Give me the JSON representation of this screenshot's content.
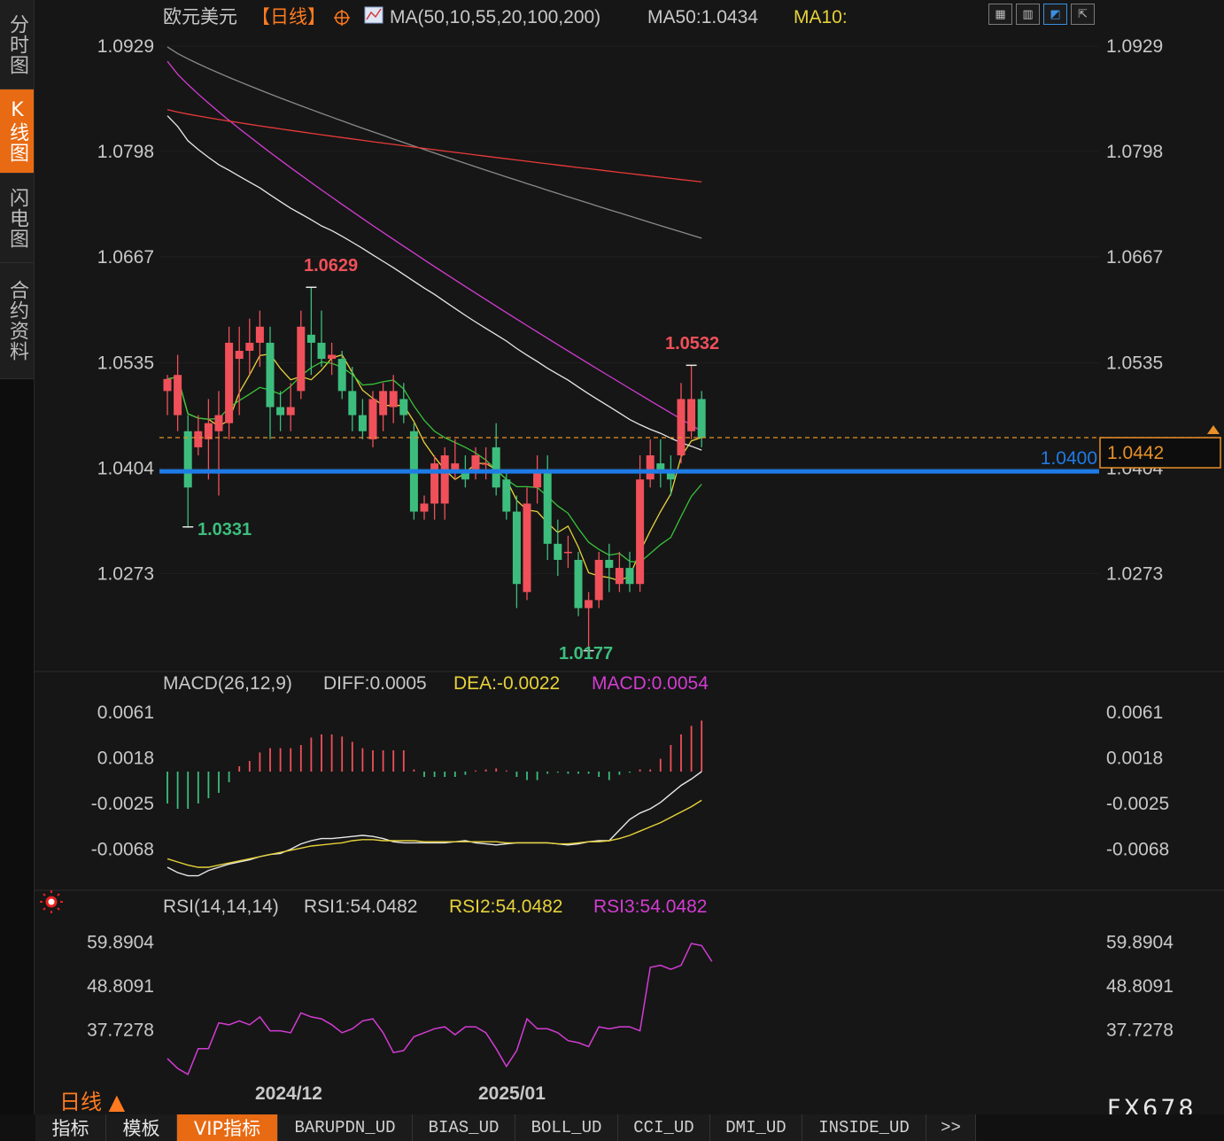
{
  "sidebar": {
    "tabs": [
      {
        "label": "分时图",
        "active": false
      },
      {
        "label": "K线图",
        "active": true
      },
      {
        "label": "闪电图",
        "active": false
      },
      {
        "label": "合约资料",
        "active": false
      }
    ]
  },
  "header": {
    "symbol": "欧元美元",
    "period": "【日线】",
    "indicator": "MA(50,10,55,20,100,200)",
    "ma50": "MA50:1.0434",
    "ma10": "MA10:"
  },
  "price_axis": {
    "ticks": [
      "1.0929",
      "1.0798",
      "1.0667",
      "1.0535",
      "1.0404",
      "1.0273"
    ],
    "current_price": "1.0442",
    "support_line": "1.0400",
    "high_label": "1.0629",
    "low_label": "1.0331",
    "recent_high_label": "1.0532",
    "recent_low_label": "1.0177"
  },
  "macd": {
    "title": "MACD(26,12,9)",
    "diff": "DIFF:0.0005",
    "dea": "DEA:-0.0022",
    "macd": "MACD:0.0054",
    "ticks": [
      "0.0061",
      "0.0018",
      "-0.0025",
      "-0.0068"
    ]
  },
  "rsi": {
    "title": "RSI(14,14,14)",
    "rsi1": "RSI1:54.0482",
    "rsi2": "RSI2:54.0482",
    "rsi3": "RSI3:54.0482",
    "ticks": [
      "59.8904",
      "48.8091",
      "37.7278"
    ]
  },
  "time_axis": [
    "2024/12",
    "2025/01"
  ],
  "period_switch": "日线 ▲",
  "bottom_tabs": [
    "指标",
    "模板",
    "VIP指标",
    "BARUPDN_UD",
    "BIAS_UD",
    "BOLL_UD",
    "CCI_UD",
    "DMI_UD",
    "INSIDE_UD",
    ">>"
  ],
  "brand": "FX678",
  "colors": {
    "up": "#f0505a",
    "down": "#3dbd7d",
    "ma_white": "#e8e8e8",
    "ma_yellow": "#e6d23a",
    "ma_green": "#39c43a",
    "ma_magenta": "#d23cd2",
    "ma_gray": "#8a8a8a",
    "ma_red": "#e83a3a",
    "support": "#1e7be6",
    "accent": "#e86a12"
  },
  "chart_data": {
    "type": "candlestick",
    "title": "欧元美元【日线】",
    "dates": [
      "2024/12",
      "2025/01"
    ],
    "ohlc": [
      [
        1.05,
        1.052,
        1.047,
        1.0515
      ],
      [
        1.047,
        1.0545,
        1.045,
        1.052
      ],
      [
        1.045,
        1.047,
        1.033,
        1.038
      ],
      [
        1.043,
        1.047,
        1.042,
        1.045
      ],
      [
        1.044,
        1.049,
        1.039,
        1.046
      ],
      [
        1.045,
        1.05,
        1.037,
        1.047
      ],
      [
        1.046,
        1.058,
        1.044,
        1.056
      ],
      [
        1.054,
        1.058,
        1.047,
        1.055
      ],
      [
        1.055,
        1.059,
        1.052,
        1.056
      ],
      [
        1.056,
        1.06,
        1.053,
        1.058
      ],
      [
        1.056,
        1.058,
        1.044,
        1.048
      ],
      [
        1.048,
        1.05,
        1.045,
        1.047
      ],
      [
        1.047,
        1.051,
        1.045,
        1.048
      ],
      [
        1.05,
        1.06,
        1.049,
        1.058
      ],
      [
        1.057,
        1.0629,
        1.052,
        1.056
      ],
      [
        1.056,
        1.06,
        1.053,
        1.054
      ],
      [
        1.054,
        1.056,
        1.052,
        1.0545
      ],
      [
        1.054,
        1.055,
        1.049,
        1.05
      ],
      [
        1.05,
        1.053,
        1.045,
        1.047
      ],
      [
        1.047,
        1.049,
        1.044,
        1.045
      ],
      [
        1.044,
        1.05,
        1.043,
        1.049
      ],
      [
        1.047,
        1.051,
        1.045,
        1.05
      ],
      [
        1.048,
        1.052,
        1.046,
        1.05
      ],
      [
        1.049,
        1.051,
        1.046,
        1.047
      ],
      [
        1.045,
        1.046,
        1.034,
        1.035
      ],
      [
        1.035,
        1.037,
        1.034,
        1.036
      ],
      [
        1.036,
        1.042,
        1.034,
        1.041
      ],
      [
        1.036,
        1.043,
        1.034,
        1.042
      ],
      [
        1.04,
        1.044,
        1.039,
        1.041
      ],
      [
        1.04,
        1.042,
        1.038,
        1.039
      ],
      [
        1.04,
        1.043,
        1.039,
        1.042
      ],
      [
        1.041,
        1.043,
        1.039,
        1.041
      ],
      [
        1.043,
        1.046,
        1.037,
        1.038
      ],
      [
        1.039,
        1.04,
        1.034,
        1.035
      ],
      [
        1.035,
        1.037,
        1.023,
        1.026
      ],
      [
        1.025,
        1.038,
        1.024,
        1.036
      ],
      [
        1.038,
        1.042,
        1.036,
        1.04
      ],
      [
        1.04,
        1.042,
        1.029,
        1.031
      ],
      [
        1.031,
        1.034,
        1.027,
        1.029
      ],
      [
        1.03,
        1.032,
        1.028,
        1.03
      ],
      [
        1.029,
        1.03,
        1.022,
        1.023
      ],
      [
        1.023,
        1.025,
        1.0177,
        1.024
      ],
      [
        1.024,
        1.03,
        1.023,
        1.029
      ],
      [
        1.029,
        1.031,
        1.025,
        1.028
      ],
      [
        1.026,
        1.03,
        1.025,
        1.028
      ],
      [
        1.028,
        1.03,
        1.025,
        1.026
      ],
      [
        1.026,
        1.042,
        1.025,
        1.039
      ],
      [
        1.039,
        1.044,
        1.038,
        1.042
      ],
      [
        1.041,
        1.044,
        1.038,
        1.04
      ],
      [
        1.04,
        1.042,
        1.037,
        1.039
      ],
      [
        1.042,
        1.051,
        1.041,
        1.049
      ],
      [
        1.045,
        1.0532,
        1.044,
        1.049
      ],
      [
        1.049,
        1.05,
        1.043,
        1.0442
      ]
    ],
    "ylim": [
      1.016,
      1.094
    ],
    "highlights": {
      "high": 1.0629,
      "low": 1.0331,
      "recent_high": 1.0532,
      "recent_low": 1.0177,
      "support": 1.04,
      "last": 1.0442
    },
    "macd": {
      "ylim": [
        -0.01,
        0.007
      ],
      "histogram": [
        -0.003,
        -0.0035,
        -0.0035,
        -0.003,
        -0.0025,
        -0.002,
        -0.001,
        0.0005,
        0.001,
        0.0018,
        0.0022,
        0.0022,
        0.0022,
        0.0025,
        0.0032,
        0.0035,
        0.0035,
        0.0033,
        0.0028,
        0.0022,
        0.002,
        0.002,
        0.002,
        0.002,
        0.0002,
        -0.0005,
        -0.0005,
        -0.0005,
        -0.0005,
        -0.0003,
        0.0001,
        0.0002,
        0.0003,
        0.0001,
        -0.0005,
        -0.0008,
        -0.0008,
        -0.0002,
        -0.0001,
        -0.0002,
        -0.0002,
        -0.0002,
        -0.0005,
        -0.0008,
        -0.0003,
        -0.0001,
        0.0002,
        0.0002,
        0.0012,
        0.0025,
        0.0035,
        0.0043,
        0.0048,
        0.0053,
        0.0058,
        0.0058,
        0.0054
      ],
      "diff": [
        -0.0085,
        -0.009,
        -0.0093,
        -0.0093,
        -0.0088,
        -0.0085,
        -0.0082,
        -0.008,
        -0.0078,
        -0.0075,
        -0.0073,
        -0.0072,
        -0.0068,
        -0.0063,
        -0.006,
        -0.0058,
        -0.0058,
        -0.0057,
        -0.0056,
        -0.0055,
        -0.0056,
        -0.0058,
        -0.0061,
        -0.0062,
        -0.0062,
        -0.0062,
        -0.0062,
        -0.0062,
        -0.0061,
        -0.006,
        -0.0062,
        -0.0063,
        -0.0064,
        -0.0063,
        -0.0062,
        -0.0062,
        -0.0062,
        -0.0062,
        -0.0063,
        -0.0064,
        -0.0063,
        -0.0061,
        -0.006,
        -0.006,
        -0.005,
        -0.004,
        -0.0034,
        -0.003,
        -0.0024,
        -0.0016,
        -0.0008,
        -0.0002,
        0.0005
      ],
      "dea": [
        -0.0077,
        -0.008,
        -0.0083,
        -0.0085,
        -0.0085,
        -0.0083,
        -0.0081,
        -0.0079,
        -0.0077,
        -0.0075,
        -0.0073,
        -0.0071,
        -0.0069,
        -0.0067,
        -0.0065,
        -0.0064,
        -0.0063,
        -0.0062,
        -0.006,
        -0.0059,
        -0.0059,
        -0.006,
        -0.006,
        -0.006,
        -0.006,
        -0.0061,
        -0.0061,
        -0.0061,
        -0.0061,
        -0.0061,
        -0.0061,
        -0.0061,
        -0.0061,
        -0.0062,
        -0.0062,
        -0.0062,
        -0.0062,
        -0.0062,
        -0.0063,
        -0.0063,
        -0.0062,
        -0.0061,
        -0.0061,
        -0.006,
        -0.0058,
        -0.0055,
        -0.0051,
        -0.0047,
        -0.0043,
        -0.0038,
        -0.0033,
        -0.0028,
        -0.0022
      ]
    },
    "rsi": {
      "ylim": [
        26.0,
        64.0
      ],
      "values": [
        30.5,
        28.0,
        26.5,
        33.0,
        33.0,
        39.5,
        39.0,
        40.0,
        39.0,
        41.0,
        37.5,
        37.5,
        37.0,
        42.0,
        41.0,
        40.5,
        39.0,
        37.0,
        38.0,
        40.0,
        40.5,
        37.0,
        32.0,
        32.5,
        36.0,
        37.0,
        38.0,
        38.5,
        36.5,
        38.5,
        38.5,
        37.0,
        33.0,
        28.5,
        32.5,
        40.5,
        38.0,
        38.0,
        37.0,
        35.0,
        34.5,
        33.5,
        38.5,
        38.0,
        38.5,
        38.5,
        37.5,
        53.5,
        54.0,
        53.0,
        54.0,
        59.5,
        59.0,
        55.0
      ],
      "series": [
        {
          "name": "RSI1",
          "value": 54.0482
        },
        {
          "name": "RSI2",
          "value": 54.0482
        },
        {
          "name": "RSI3",
          "value": 54.0482
        }
      ]
    }
  }
}
